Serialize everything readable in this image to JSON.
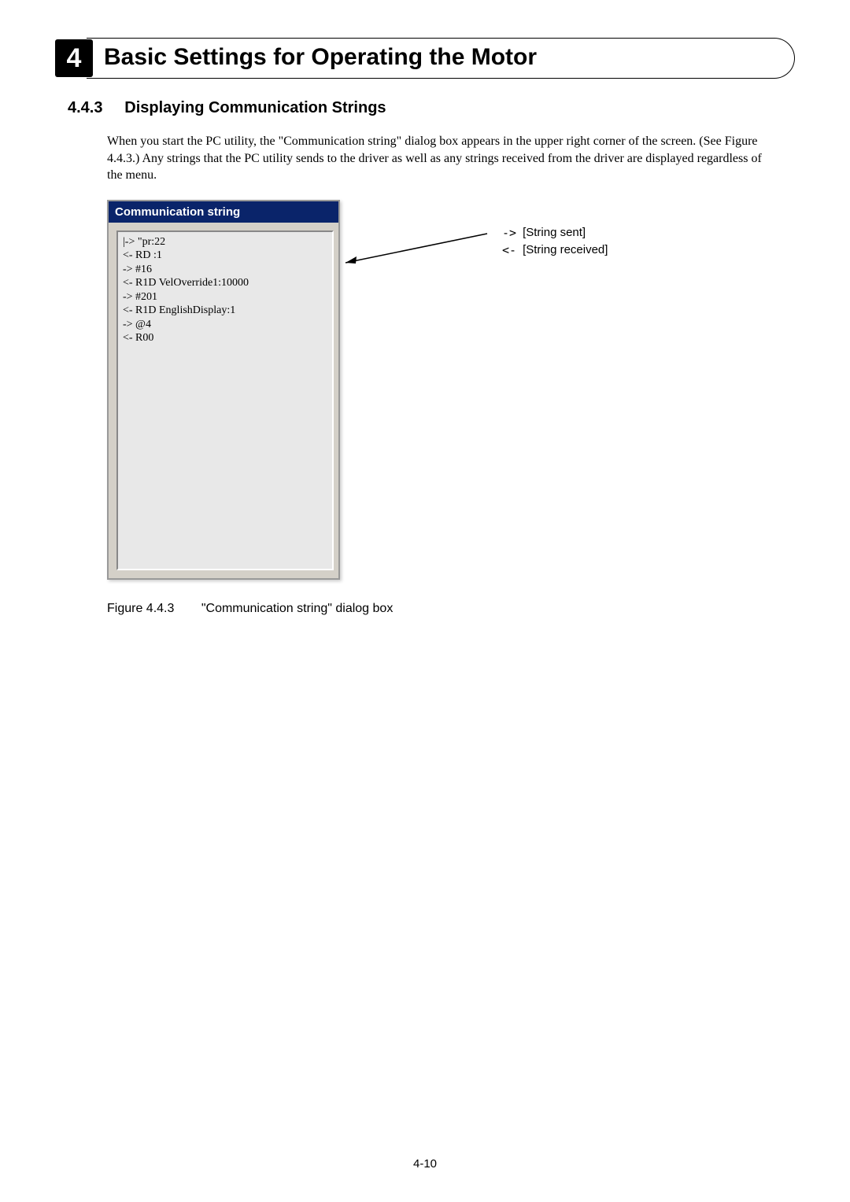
{
  "chapter": {
    "number": "4",
    "title": "Basic Settings for Operating the Motor"
  },
  "section": {
    "number": "4.4.3",
    "title": "Displaying Communication Strings"
  },
  "paragraph": "When you start the PC utility, the \"Communication string\" dialog box appears in the upper right corner of the screen. (See Figure 4.4.3.) Any strings that the PC utility sends to the driver as well as any strings received from the driver are displayed regardless of the menu.",
  "dialog": {
    "title": "Communication string",
    "lines": [
      "|-> \"pr:22",
      "<- RD :1",
      "-> #16",
      "<- R1D VelOverride1:10000",
      "-> #201",
      "<- R1D EnglishDisplay:1",
      "-> @4",
      "<- R00"
    ]
  },
  "annotations": {
    "sent": {
      "arrow": "->",
      "label": "[String sent]"
    },
    "received": {
      "arrow": "<-",
      "label": "[String received]"
    }
  },
  "figure": {
    "number": "Figure 4.4.3",
    "caption": "\"Communication string\" dialog box"
  },
  "page_number": "4-10"
}
